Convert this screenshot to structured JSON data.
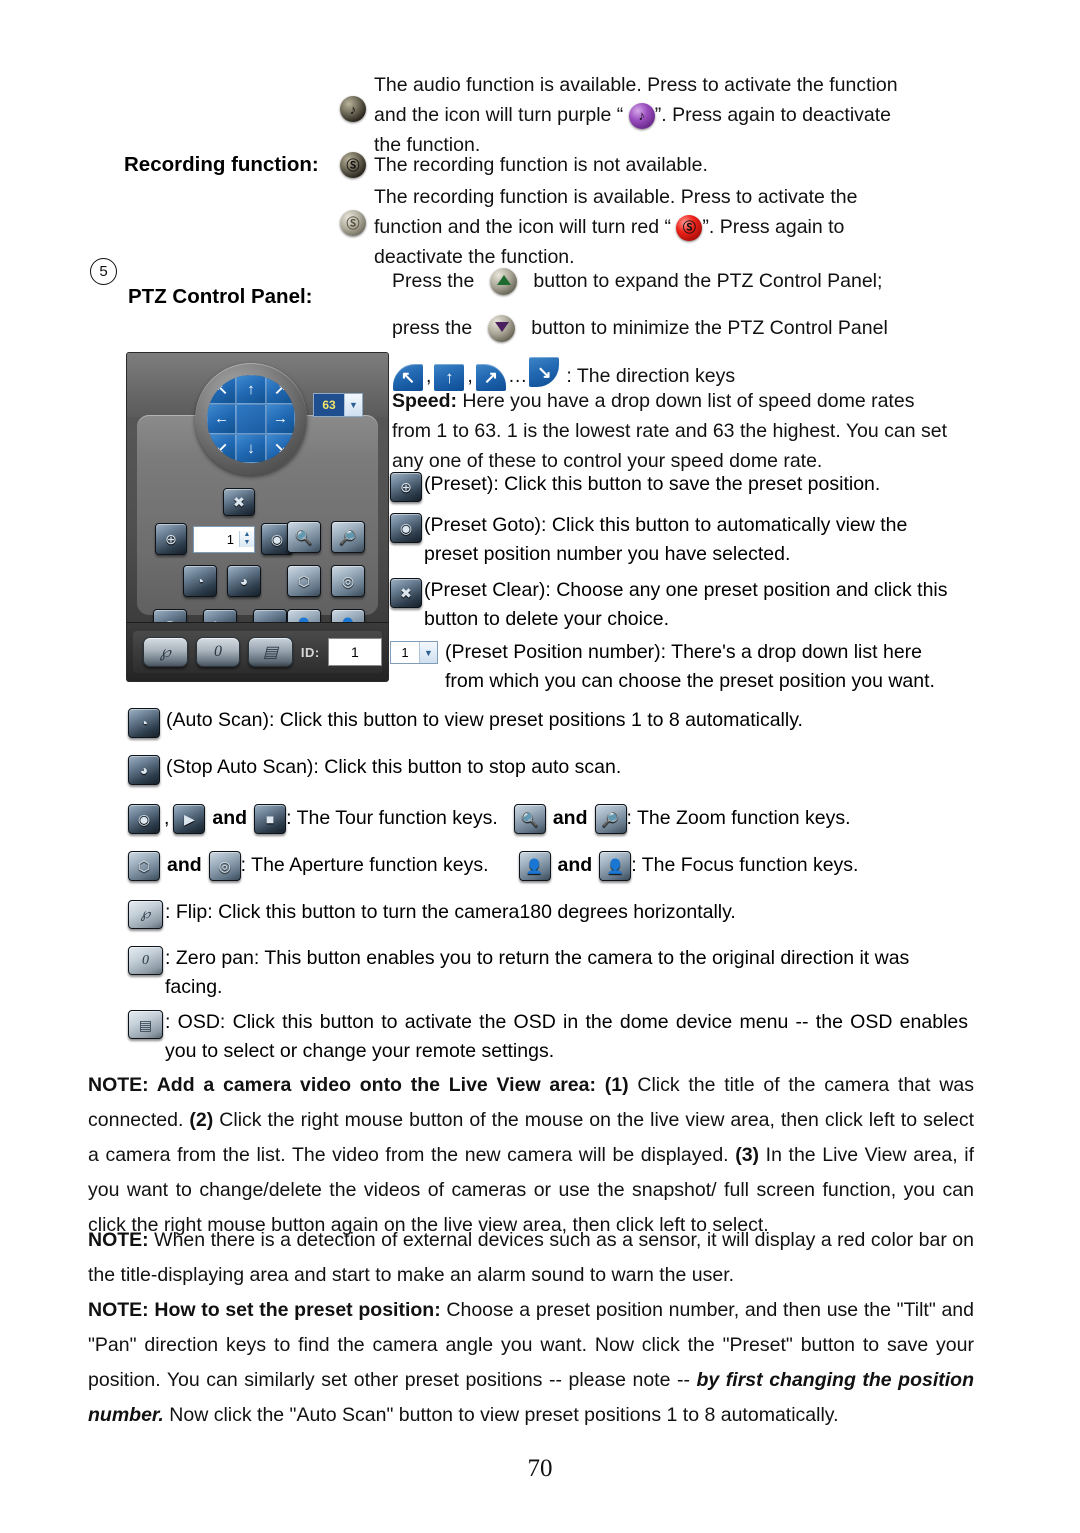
{
  "page": {
    "number": "70"
  },
  "audio": {
    "icon_available": "audio-icon-dark",
    "icon_active": "audio-icon-purple",
    "text_1": "The audio function is available. Press to activate the function",
    "text_2a": "and the icon will turn purple “",
    "text_2b": "”. Press again to deactivate",
    "text_3": "the function."
  },
  "recording": {
    "label": "Recording function:",
    "not_available_text": "The recording function is not available.",
    "available_text_1": "The recording function is available. Press to activate the",
    "available_text_2a": "function and the icon will turn red “",
    "available_text_2b": "”. Press again to",
    "available_text_3": "deactivate the function."
  },
  "ptz_section": {
    "marker": "5",
    "label": "PTZ Control Panel:",
    "expand_text_a": "Press the",
    "expand_text_b": "button to expand the PTZ Control Panel;",
    "minimize_text_a": "press the",
    "minimize_text_b": "button to minimize the PTZ Control Panel",
    "direction_keys_sep1": ",",
    "direction_keys_sep2": ",",
    "direction_keys_ellipsis": "…",
    "direction_keys_label": ": The direction keys",
    "speed_label": "Speed:",
    "speed_text": " Here you have a drop down list of speed dome rates from 1 to 63. 1 is the lowest rate and 63 the highest. You can set any one of these to control your speed dome rate."
  },
  "ptz_panel": {
    "joystick_arrows": [
      "↖",
      "↑",
      "↗",
      "←",
      "",
      "→",
      "↙",
      "↓",
      "↘"
    ],
    "speed_value": "63",
    "preset_number_value": "1",
    "id_label": "ID:",
    "id_value": "1",
    "flip_glyph": "℘",
    "zero_pan_glyph": "0",
    "osd_glyph": "▤",
    "buttons": {
      "preset_clear": "✖",
      "preset": "⊕",
      "preset_goto": "◉",
      "auto_scan": "◔",
      "stop_auto_scan": "◕",
      "tour_start": "◉",
      "tour_play": "▶",
      "tour_stop": "■",
      "zoom_in": "⊕",
      "zoom_out": "⊖",
      "aperture_open": "⬡",
      "aperture_close": "◎",
      "focus_near": "⬟",
      "focus_far": "⬟"
    }
  },
  "preset_items": [
    {
      "icon": "preset-icon",
      "glyph": "⊕",
      "text": "(Preset): Click this button to save the preset position."
    },
    {
      "icon": "preset-goto-icon",
      "glyph": "◉",
      "text": "(Preset Goto): Click this button to automatically view the preset position number you have selected."
    },
    {
      "icon": "preset-clear-icon",
      "glyph": "✖",
      "text": "(Preset Clear): Choose any one preset position and click this button to delete your choice."
    }
  ],
  "preset_position_number": {
    "select_value": "1",
    "text": "(Preset Position number): There's a drop down list here from which you can choose the preset position you want."
  },
  "scan_items": [
    {
      "icon": "auto-scan-icon",
      "glyph": "◔",
      "text": "(Auto Scan): Click this button to view preset positions 1 to 8 automatically."
    },
    {
      "icon": "stop-auto-scan-icon",
      "glyph": "◕",
      "text": "(Stop Auto Scan): Click this button to stop auto scan."
    }
  ],
  "function_keys": {
    "tour_sep": ",",
    "tour_and": "and",
    "tour_text": ": The Tour function keys.",
    "zoom_and": "and",
    "zoom_text": ": The Zoom function keys.",
    "aperture_and": "and",
    "aperture_text": ": The Aperture function keys.",
    "focus_and": "and",
    "focus_text": ": The Focus function keys."
  },
  "bottom_items": [
    {
      "icon": "flip-icon",
      "glyph": "℘",
      "text": ": Flip: Click this button to turn the camera180 degrees horizontally."
    },
    {
      "icon": "zero-pan-icon",
      "glyph": "0",
      "text": ": Zero pan: This button enables you to return the camera to the original direction it was facing."
    },
    {
      "icon": "osd-icon",
      "glyph": "▤",
      "text": ": OSD: Click this button to activate the OSD in the dome device menu -- the OSD enables you to select or change your remote settings."
    }
  ],
  "notes": {
    "note1_bold": "NOTE: Add a camera video onto the Live View area:",
    "note1_n1": " (1)",
    "note1_t1": " Click the title of the camera that was connected.",
    "note1_n2": " (2)",
    "note1_t2": " Click the right mouse button of the mouse on the live view area, then click left to select a camera from the list. The video from the new camera will be displayed.",
    "note1_n3": " (3)",
    "note1_t3": " In the Live View area, if you want to change/delete the videos of cameras or use the snapshot/ full screen function, you can click the right mouse button again on the live view area, then click left to select.",
    "note2_bold": "NOTE:",
    "note2_text": " When there is a detection of external devices such as a sensor, it will display a red color bar on the title-displaying area and start to make an alarm sound to warn the user.",
    "note3_bold": "NOTE: How to set the preset position:",
    "note3_text": " Choose a preset position number, and then use the \"Tilt\" and \"Pan\" direction keys to find the camera angle you want. Now click the \"Preset\" button to save your position. You can similarly set other preset positions -- please note -- ",
    "note3_italic": "by first changing the position number.",
    "note3_tail": " Now click the \"Auto Scan\" button to view preset positions 1 to 8 automatically."
  }
}
